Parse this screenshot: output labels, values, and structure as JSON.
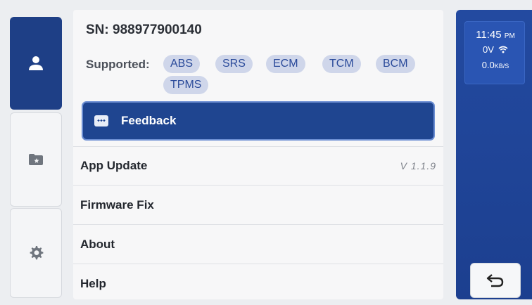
{
  "rail": {
    "tabs": [
      {
        "icon": "user-icon",
        "active": true
      },
      {
        "icon": "folder-star-icon",
        "active": false
      },
      {
        "icon": "settings-gear-icon",
        "active": false
      }
    ]
  },
  "info": {
    "sn_label": "SN:",
    "sn_value": "988977900140",
    "supported_label": "Supported:",
    "systems": [
      "ABS",
      "SRS",
      "ECM",
      "TCM",
      "BCM",
      "TPMS"
    ]
  },
  "feedback": {
    "label": "Feedback",
    "icon": "chat-bubble-icon"
  },
  "menu": [
    {
      "label": "App Update",
      "value": "V 1.1.9"
    },
    {
      "label": "Firmware Fix",
      "value": ""
    },
    {
      "label": "About",
      "value": ""
    },
    {
      "label": "Help",
      "value": ""
    }
  ],
  "status": {
    "time": "11:45",
    "ampm": "PM",
    "voltage": "0V",
    "wifi_icon": "wifi-icon",
    "speed": "0.0",
    "speed_unit": "KB/S"
  },
  "back_button": {
    "icon": "back-arrow-icon"
  },
  "colors": {
    "accent": "#1f4590",
    "chip_bg": "#cfd6ea",
    "chip_text": "#2a4a9a",
    "panel_bg": "#f7f7f8"
  }
}
